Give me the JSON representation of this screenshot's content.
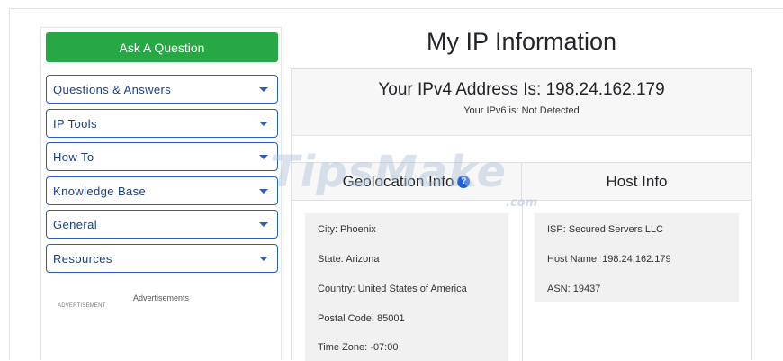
{
  "sidebar": {
    "ask_button": "Ask A Question",
    "menus": [
      {
        "label": "Questions & Answers"
      },
      {
        "label": "IP Tools"
      },
      {
        "label": "How To"
      },
      {
        "label": "Knowledge Base"
      },
      {
        "label": "General"
      },
      {
        "label": "Resources"
      }
    ],
    "ads_label": "Advertisements",
    "ad_small": "ADVERTISEMENT"
  },
  "main": {
    "title": "My IP Information",
    "ipv4_text": "Your IPv4 Address Is: 198.24.162.179",
    "ipv6_text": "Your IPv6 is: Not Detected",
    "geo": {
      "heading": "Geolocation Info",
      "help_icon": "question-circle-icon",
      "rows": [
        "City: Phoenix",
        "State: Arizona",
        "Country: United States of America",
        "Postal Code: 85001",
        "Time Zone: -07:00"
      ]
    },
    "host": {
      "heading": "Host Info",
      "rows": [
        "ISP: Secured Servers LLC",
        "Host Name: 198.24.162.179",
        "ASN: 19437"
      ]
    }
  },
  "watermark": {
    "text": "TipsMake",
    "suffix": ".com"
  },
  "colors": {
    "green": "#28a745",
    "blue_border": "#2b5fb8",
    "help_blue": "#1a5fd6"
  }
}
